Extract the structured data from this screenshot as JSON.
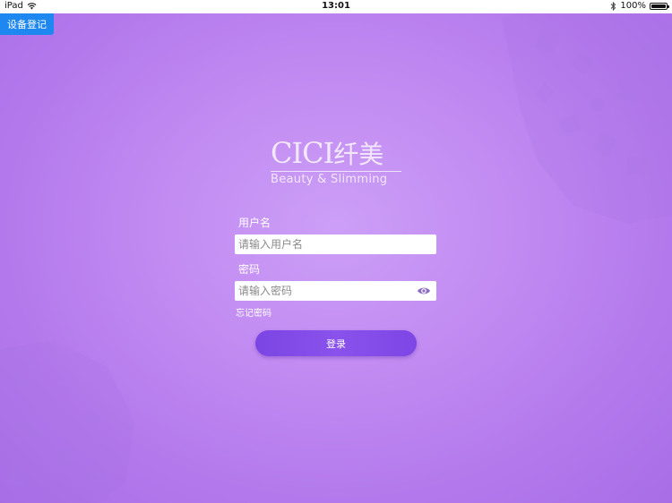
{
  "status_bar": {
    "device": "iPad",
    "time": "13:01",
    "battery_percent": "100%",
    "battery_level": 1.0,
    "wifi_icon": "wifi-icon",
    "bluetooth_icon": "bluetooth-icon"
  },
  "device_register": {
    "label": "设备登记"
  },
  "logo": {
    "brand_latin": "CICI",
    "brand_chinese": "纤美",
    "tagline": "Beauty & Slimming"
  },
  "form": {
    "username_label": "用户名",
    "username_placeholder": "请输入用户名",
    "username_value": "",
    "password_label": "密码",
    "password_placeholder": "请输入密码",
    "password_value": "",
    "show_password_icon": "eye-icon",
    "forgot_password": "忘记密码",
    "login_button": "登录"
  },
  "colors": {
    "background": "#c28cf2",
    "device_button": "#1e88f0",
    "login_button": "#8a52ec",
    "text": "#ffffff"
  }
}
